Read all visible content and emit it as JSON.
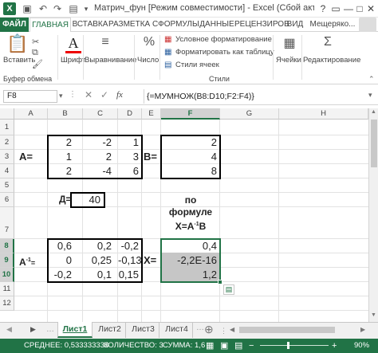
{
  "window": {
    "title": "Матрич_фун  [Режим совместимости] - Excel (Сбой актива...",
    "help": "?",
    "restore": "▭",
    "minimize": "—",
    "maximize": "□",
    "close": "✕"
  },
  "ribbon_tabs": [
    "ФАЙЛ",
    "ГЛАВНАЯ",
    "ВСТАВКА",
    "РАЗМЕТКА С",
    "ФОРМУЛЫ",
    "ДАННЫЕ",
    "РЕЦЕНЗИРОВ",
    "ВИД",
    "Мещеряко..."
  ],
  "ribbon": {
    "paste": "Вставить",
    "clipboard_group": "Буфер обмена",
    "font": "Шрифт",
    "alignment": "Выравнивание",
    "number": "Число",
    "cond_format": "Условное форматирование",
    "format_table": "Форматировать как таблицу",
    "cell_styles": "Стили ячеек",
    "styles_group": "Стили",
    "cells": "Ячейки",
    "editing": "Редактирование"
  },
  "formula_bar": {
    "name_box": "F8",
    "formula": "{=МУМНОЖ(B8:D10;F2:F4)}",
    "fx": "fx"
  },
  "grid": {
    "columns": [
      "A",
      "B",
      "C",
      "D",
      "E",
      "F",
      "G",
      "H"
    ],
    "rows": [
      "1",
      "2",
      "3",
      "4",
      "5",
      "6",
      "7",
      "8",
      "9",
      "10",
      "11",
      "12"
    ],
    "selected_col": "F",
    "selected_rows": [
      "8",
      "9",
      "10"
    ],
    "cells": {
      "A3": "A=",
      "B2": "2",
      "C2": "-2",
      "D2": "1",
      "B3": "1",
      "C3": "2",
      "D3": "3",
      "B4": "2",
      "C4": "-4",
      "D4": "6",
      "E3": "B=",
      "F2": "2",
      "F3": "4",
      "F4": "8",
      "C6_label": "Д=",
      "D6": "40",
      "F7_line1": "по",
      "F7_line2": "формуле",
      "F7_line3": "X=A",
      "F7_sup": "-1",
      "F7_line3b": "B",
      "A9": "A",
      "A9_sup": "-1",
      "A9_eq": "=",
      "B8": "0,6",
      "C8": "0,2",
      "D8": "-0,2",
      "B9": "0",
      "C9": "0,25",
      "D9": "-0,13",
      "B10": "-0,2",
      "C10": "0,1",
      "D10": "0,15",
      "E9": "X=",
      "F8": "0,4",
      "F9": "-2,2E-16",
      "F10": "1,2"
    }
  },
  "sheets": [
    "Лист1",
    "Лист2",
    "Лист3",
    "Лист4"
  ],
  "active_sheet": "Лист1",
  "status": {
    "average": "СРЕДНЕЕ: 0,533333333",
    "count": "КОЛИЧЕСТВО: 3",
    "sum": "СУММА: 1,6",
    "zoom": "90%"
  }
}
